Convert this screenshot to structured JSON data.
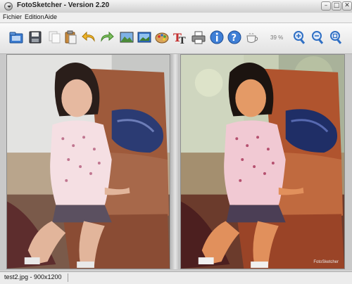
{
  "window": {
    "title": "FotoSketcher - Version 2.20"
  },
  "menu": {
    "items": [
      "Fichier",
      "Edition",
      "Aide"
    ]
  },
  "toolbar": {
    "zoom": "39 %"
  },
  "canvas": {
    "credit": "FotoSketcher"
  },
  "status": {
    "file": "test2.jpg - 900x1200"
  },
  "colors": {
    "accent": "#2f6fc4",
    "undo": "#f0b428",
    "redo": "#5aaf3c"
  }
}
